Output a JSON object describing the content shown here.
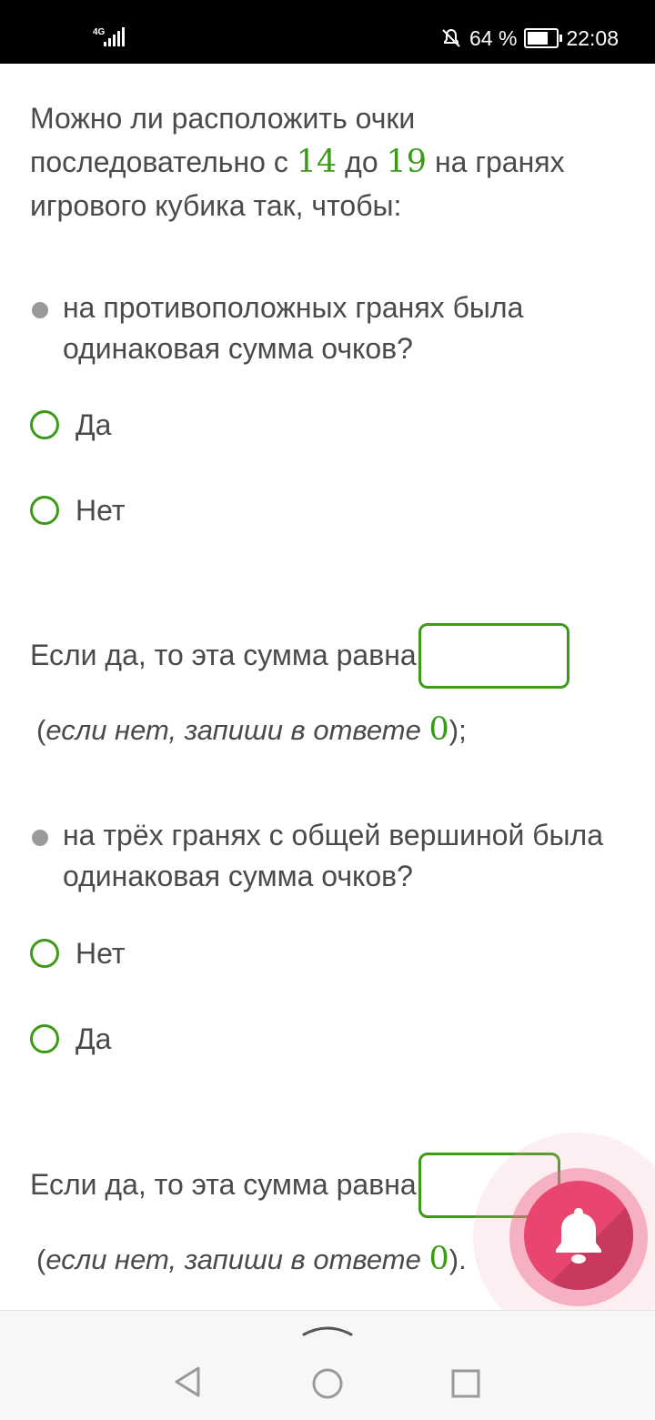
{
  "status_bar": {
    "network": "4G",
    "battery_percent": "64 %",
    "time": "22:08"
  },
  "intro": {
    "part1": "Можно ли расположить очки последовательно с ",
    "from": "14",
    "part2": " до ",
    "to": "19",
    "part3": " на гранях игрового кубика так, чтобы:"
  },
  "question1": {
    "text": " на противоположных гранях была одинаковая сумма очков?",
    "options": [
      "Да",
      "Нет"
    ],
    "sum_label": "Если да, то эта сумма равна",
    "answer_value": "",
    "note_open": "(",
    "note_text": "если нет, запиши в ответе ",
    "note_zero": "0",
    "note_close": ");"
  },
  "question2": {
    "text": " на трёх гранях с общей вершиной была одинаковая сумма очков?",
    "options": [
      "Нет",
      "Да"
    ],
    "sum_label": "Если да, то эта сумма равна",
    "answer_value": "",
    "note_open": "(",
    "note_text": "если нет, запиши в ответе ",
    "note_zero": "0",
    "note_close": ")."
  },
  "fab": {
    "icon": "bell-icon",
    "color": "#e8466f"
  },
  "colors": {
    "accent": "#3b9b17",
    "text": "#4a4a4a"
  },
  "navigation": {
    "icons": [
      "chevron-up-icon",
      "back-icon",
      "home-icon",
      "recents-icon"
    ]
  }
}
